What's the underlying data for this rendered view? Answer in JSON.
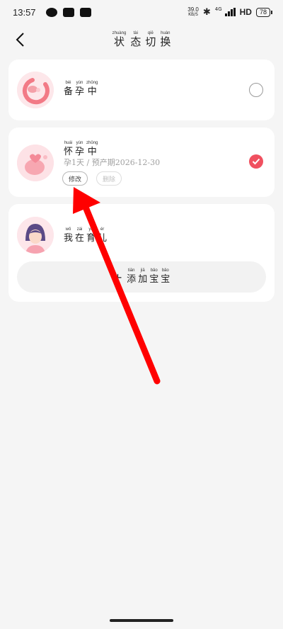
{
  "status_bar": {
    "time": "13:57",
    "net_speed_value": "39.0",
    "net_speed_unit": "KB/S",
    "signal_label": "4G",
    "network": "HD",
    "battery": "78"
  },
  "header": {
    "title": [
      {
        "pinyin": "zhuàng",
        "char": "状"
      },
      {
        "pinyin": "tài",
        "char": "态"
      },
      {
        "pinyin": "qiē",
        "char": "切"
      },
      {
        "pinyin": "huàn",
        "char": "换"
      }
    ]
  },
  "states": {
    "prepare": {
      "label": [
        {
          "pinyin": "bèi",
          "char": "备"
        },
        {
          "pinyin": "yùn",
          "char": "孕"
        },
        {
          "pinyin": "zhōng",
          "char": "中"
        }
      ],
      "selected": false
    },
    "pregnant": {
      "label": [
        {
          "pinyin": "huái",
          "char": "怀"
        },
        {
          "pinyin": "yùn",
          "char": "孕"
        },
        {
          "pinyin": "zhōng",
          "char": "中"
        }
      ],
      "due_text": "孕1天 / 预产期2026-12-30",
      "edit_label": "修改",
      "delete_label": "删除",
      "selected": true
    },
    "parenting": {
      "label": [
        {
          "pinyin": "wǒ",
          "char": "我"
        },
        {
          "pinyin": "zài",
          "char": "在"
        },
        {
          "pinyin": "yù",
          "char": "育"
        },
        {
          "pinyin": "ér",
          "char": "儿"
        }
      ],
      "add_baby": [
        {
          "pinyin": "tiān",
          "char": "添"
        },
        {
          "pinyin": "jiā",
          "char": "加"
        },
        {
          "pinyin": "bǎo",
          "char": "宝"
        },
        {
          "pinyin": "bǎo",
          "char": "宝"
        }
      ]
    }
  },
  "colors": {
    "accent": "#f0505f",
    "annotation_arrow": "#ff0000"
  }
}
